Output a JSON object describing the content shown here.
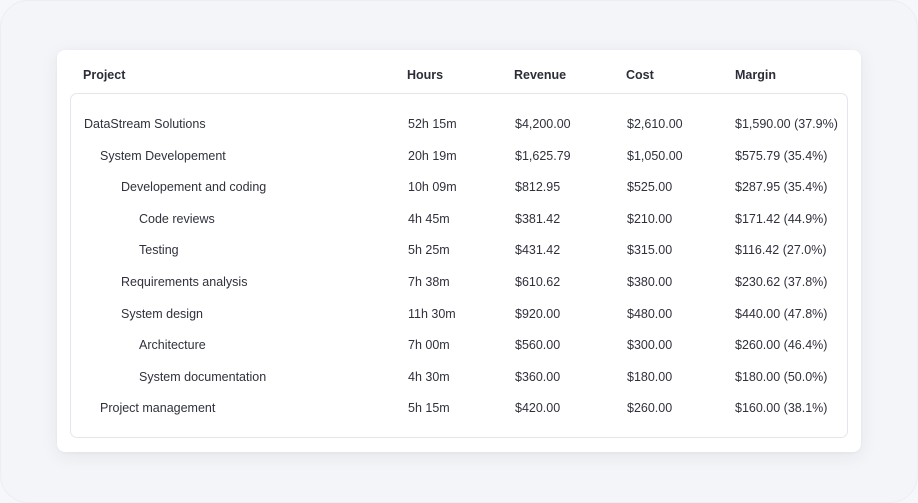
{
  "table": {
    "headers": {
      "project": "Project",
      "hours": "Hours",
      "revenue": "Revenue",
      "cost": "Cost",
      "margin": "Margin"
    },
    "rows": [
      {
        "name": "DataStream Solutions",
        "level": 0,
        "hours": "52h 15m",
        "revenue": "$4,200.00",
        "cost": "$2,610.00",
        "margin": "$1,590.00 (37.9%)"
      },
      {
        "name": "System Developement",
        "level": 1,
        "hours": "20h 19m",
        "revenue": "$1,625.79",
        "cost": "$1,050.00",
        "margin": "$575.79 (35.4%)"
      },
      {
        "name": "Developement and coding",
        "level": 2,
        "hours": "10h 09m",
        "revenue": "$812.95",
        "cost": "$525.00",
        "margin": "$287.95 (35.4%)"
      },
      {
        "name": "Code reviews",
        "level": 3,
        "hours": "4h 45m",
        "revenue": "$381.42",
        "cost": "$210.00",
        "margin": "$171.42 (44.9%)"
      },
      {
        "name": "Testing",
        "level": 3,
        "hours": "5h 25m",
        "revenue": "$431.42",
        "cost": "$315.00",
        "margin": "$116.42 (27.0%)"
      },
      {
        "name": "Requirements analysis",
        "level": 2,
        "hours": "7h 38m",
        "revenue": "$610.62",
        "cost": "$380.00",
        "margin": "$230.62 (37.8%)"
      },
      {
        "name": "System design",
        "level": 2,
        "hours": "11h 30m",
        "revenue": "$920.00",
        "cost": "$480.00",
        "margin": "$440.00 (47.8%)"
      },
      {
        "name": "Architecture",
        "level": 3,
        "hours": "7h 00m",
        "revenue": "$560.00",
        "cost": "$300.00",
        "margin": "$260.00 (46.4%)"
      },
      {
        "name": "System documentation",
        "level": 3,
        "hours": "4h 30m",
        "revenue": "$360.00",
        "cost": "$180.00",
        "margin": "$180.00 (50.0%)"
      },
      {
        "name": "Project management",
        "level": 1,
        "hours": "5h 15m",
        "revenue": "$420.00",
        "cost": "$260.00",
        "margin": "$160.00 (38.1%)"
      }
    ]
  }
}
